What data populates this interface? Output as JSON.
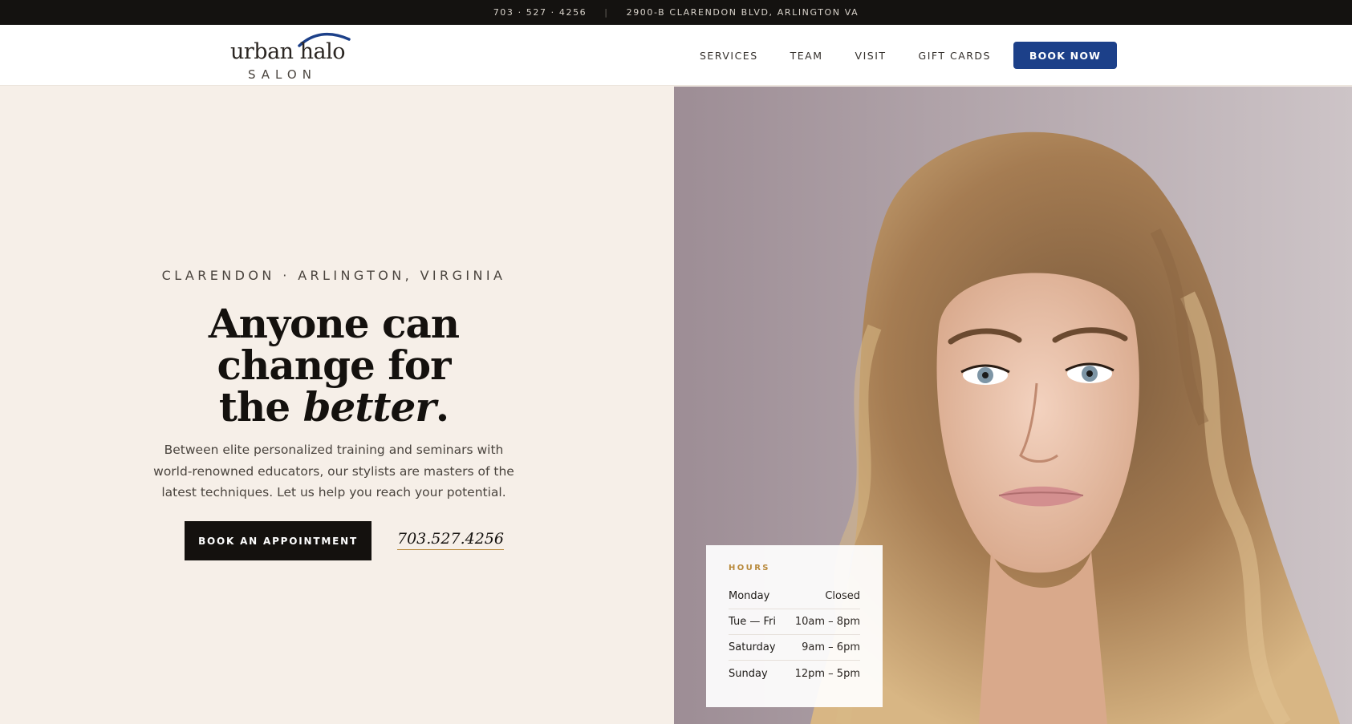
{
  "topbar": {
    "phone": "703 · 527 · 4256",
    "separator": "|",
    "address": "2900-B CLARENDON BLVD, ARLINGTON VA"
  },
  "header": {
    "logo_wordmark": "urban halo",
    "logo_sub": "SALON",
    "nav": [
      "SERVICES",
      "TEAM",
      "VISIT",
      "GIFT CARDS"
    ],
    "book_now": "BOOK NOW"
  },
  "hero": {
    "eyebrow": "CLARENDON · ARLINGTON, VIRGINIA",
    "headline_line1": "Anyone can",
    "headline_line2": "change for",
    "headline_line3_prefix": "the ",
    "headline_line3_em": "better",
    "headline_line3_suffix": ".",
    "lede": "Between elite personalized training and seminars with world-renowned educators, our stylists are masters of the latest techniques. Let us help you reach your potential.",
    "cta": "BOOK AN APPOINTMENT",
    "phone_link": "703.527.4256"
  },
  "hours": {
    "label": "HOURS",
    "rows": [
      {
        "day": "Monday",
        "time": "Closed"
      },
      {
        "day": "Tue — Fri",
        "time": "10am – 8pm"
      },
      {
        "day": "Saturday",
        "time": "9am – 6pm"
      },
      {
        "day": "Sunday",
        "time": "12pm – 5pm"
      }
    ]
  },
  "colors": {
    "accent_blue": "#1c4089",
    "gold": "#b8893b",
    "cream": "#f6efe8",
    "dark": "#14110e"
  }
}
